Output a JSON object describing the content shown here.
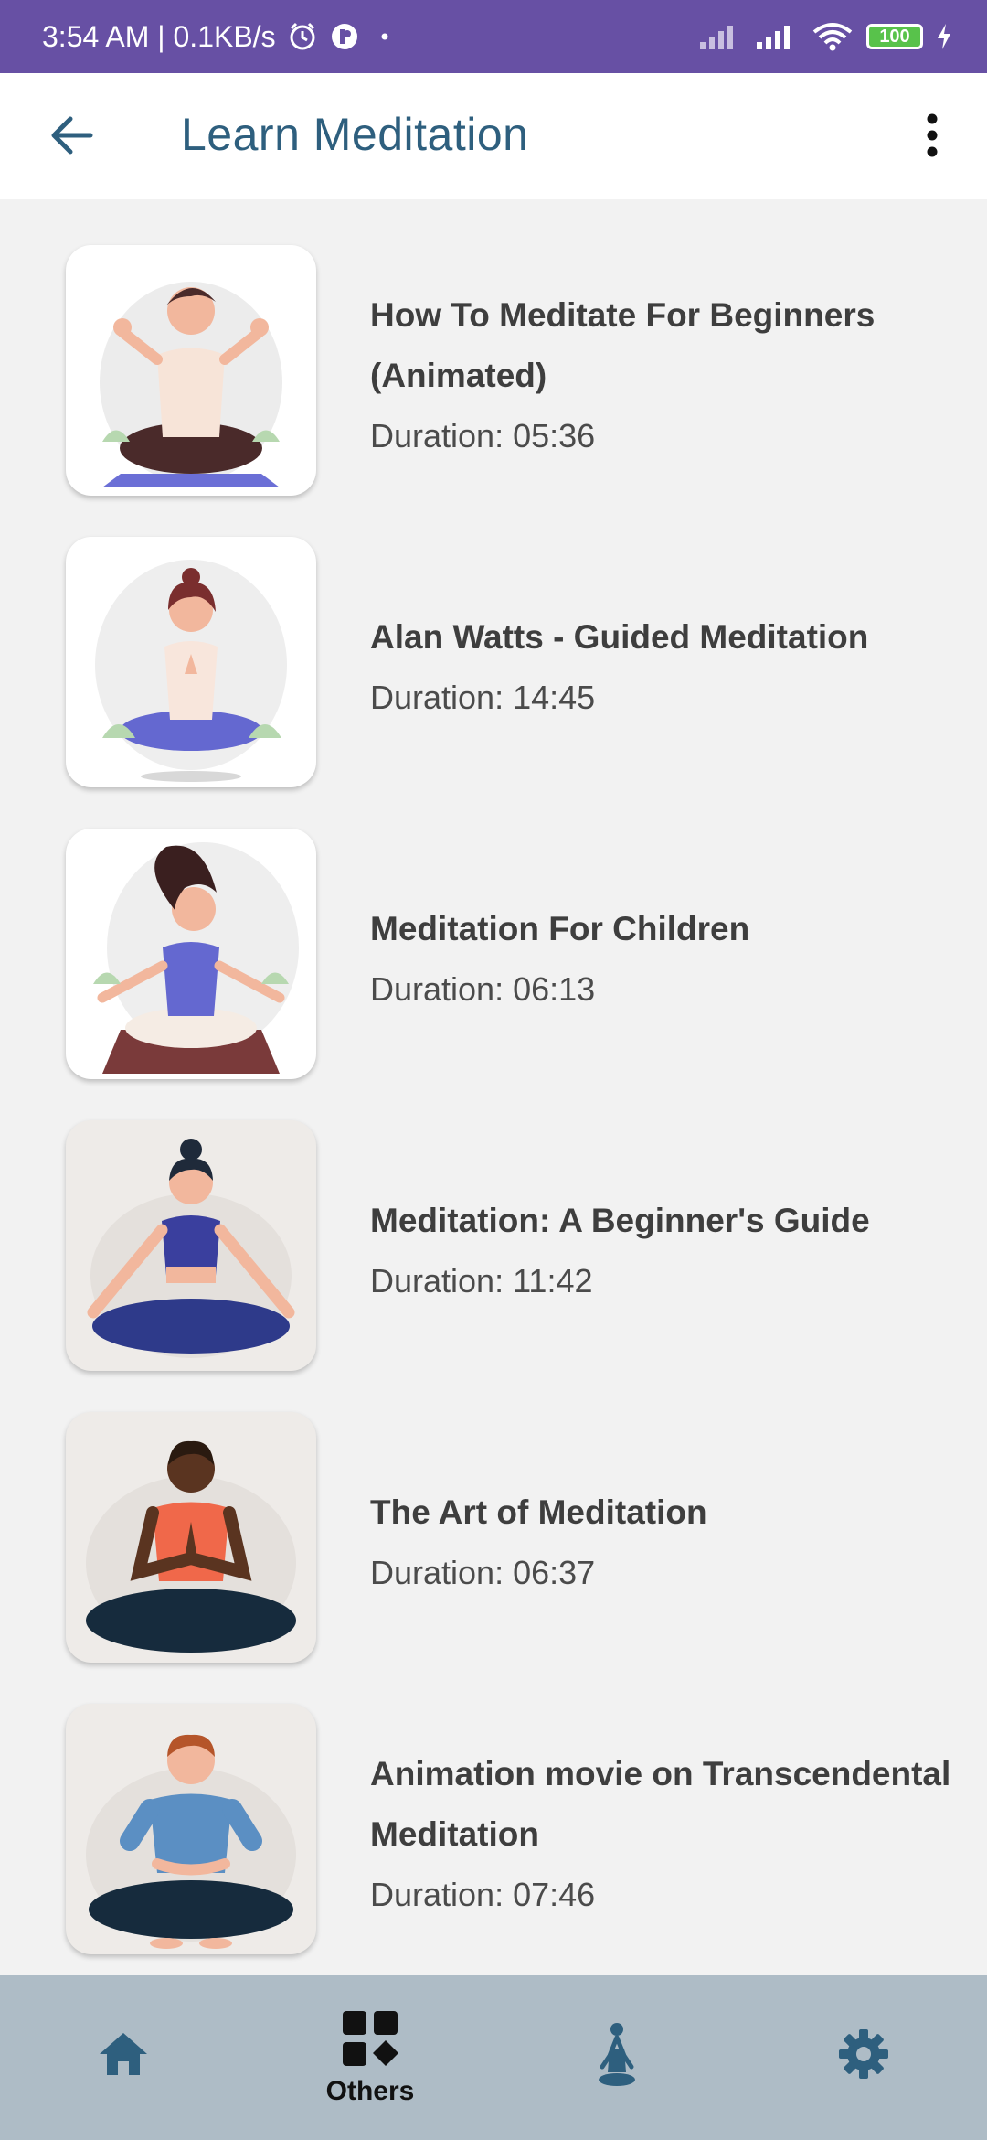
{
  "status_bar": {
    "time_speed": "3:54 AM | 0.1KB/s",
    "battery": "100",
    "icons": [
      "alarm-icon",
      "app-icon",
      "dot-icon",
      "signal-icon",
      "signal-icon",
      "wifi-icon",
      "battery-icon",
      "charging-icon"
    ]
  },
  "app_bar": {
    "title": "Learn Meditation",
    "back_icon": "arrow-left-icon",
    "menu_icon": "more-vert-icon"
  },
  "items": [
    {
      "title": "How To Meditate For Beginners (Animated)",
      "duration": "Duration: 05:36"
    },
    {
      "title": "Alan Watts - Guided Meditation",
      "duration": "Duration: 14:45"
    },
    {
      "title": "Meditation For Children",
      "duration": "Duration: 06:13"
    },
    {
      "title": "Meditation: A Beginner's Guide",
      "duration": "Duration: 11:42"
    },
    {
      "title": "The Art of Meditation",
      "duration": "Duration: 06:37"
    },
    {
      "title": "Animation movie on Transcendental Meditation",
      "duration": "Duration: 07:46"
    }
  ],
  "bottom_nav": {
    "items": [
      {
        "icon": "home-icon",
        "label": ""
      },
      {
        "icon": "grid-icon",
        "label": "Others"
      },
      {
        "icon": "meditation-icon",
        "label": ""
      },
      {
        "icon": "settings-icon",
        "label": ""
      }
    ]
  },
  "colors": {
    "status_bar": "#6750a4",
    "title": "#2e5f7e",
    "bottom_nav": "#aebcc6",
    "nav_icon": "#2e5f7e"
  }
}
